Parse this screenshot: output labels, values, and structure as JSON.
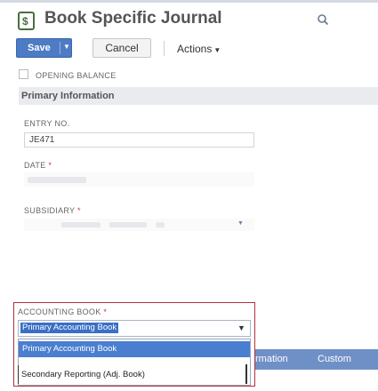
{
  "header": {
    "title": "Book Specific Journal",
    "icon": "journal-icon",
    "search_icon": "search-icon"
  },
  "toolbar": {
    "save_label": "Save",
    "cancel_label": "Cancel",
    "actions_label": "Actions"
  },
  "opening_balance": {
    "label": "OPENING BALANCE",
    "checked": false
  },
  "section": {
    "title": "Primary Information"
  },
  "fields": {
    "entry_no": {
      "label": "ENTRY NO.",
      "value": "JE471"
    },
    "date": {
      "label": "DATE",
      "required_mark": "*"
    },
    "subsidiary": {
      "label": "SUBSIDIARY",
      "required_mark": "*"
    },
    "accounting_book": {
      "label": "ACCOUNTING BOOK",
      "required_mark": "*",
      "selected": "Primary Accounting Book",
      "options": [
        "Primary Accounting Book",
        "Secondary Reporting (Adj. Book)"
      ]
    }
  },
  "subtabs": [
    "rmation",
    "Custom"
  ],
  "colors": {
    "accent": "#4d7bc4",
    "highlight_frame": "#b5303a",
    "section_bg": "#e9ebee",
    "subtab_bg": "#6f90c7"
  }
}
